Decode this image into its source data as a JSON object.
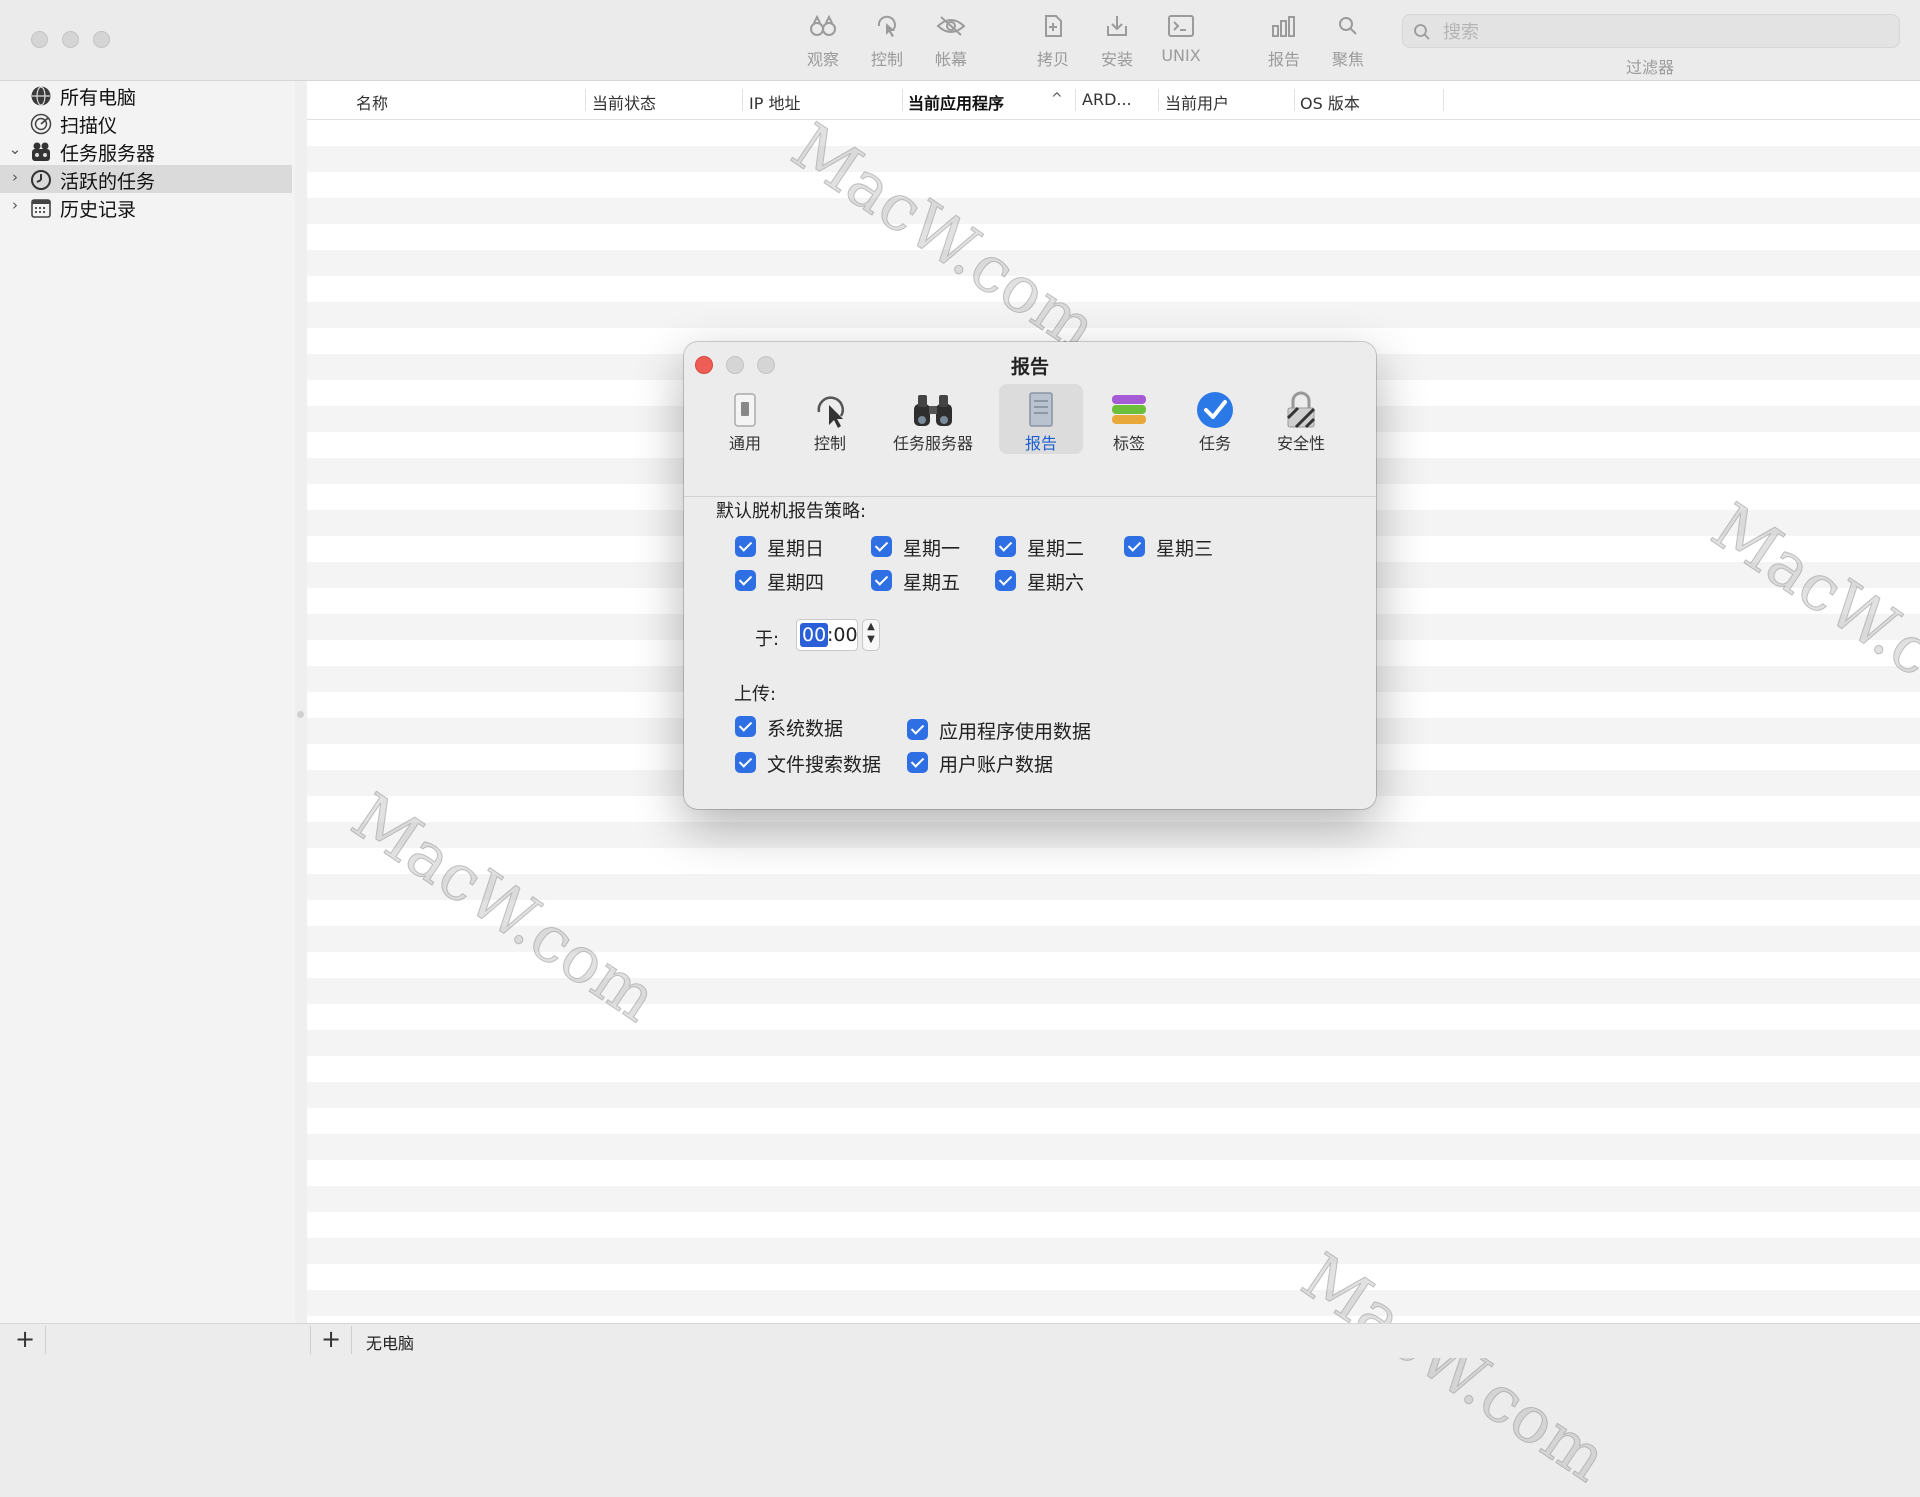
{
  "toolbar": {
    "buttons": [
      {
        "label": "观察",
        "icon": "binoculars-icon"
      },
      {
        "label": "控制",
        "icon": "control-cursor-icon"
      },
      {
        "label": "帐幕",
        "icon": "eye-slash-icon"
      },
      {
        "label": "拷贝",
        "icon": "copy-doc-icon"
      },
      {
        "label": "安装",
        "icon": "install-tray-icon"
      },
      {
        "label": "UNIX",
        "icon": "terminal-icon"
      },
      {
        "label": "报告",
        "icon": "bar-chart-icon"
      },
      {
        "label": "聚焦",
        "icon": "magnifier-icon"
      }
    ],
    "search_placeholder": "搜索",
    "filter_label": "过滤器"
  },
  "sidebar": {
    "items": [
      {
        "label": "所有电脑",
        "icon": "globe-icon",
        "chevron": ""
      },
      {
        "label": "扫描仪",
        "icon": "scanner-radar-icon",
        "chevron": ""
      },
      {
        "label": "任务服务器",
        "icon": "task-server-icon",
        "chevron": "⌄"
      },
      {
        "label": "活跃的任务",
        "icon": "clock-icon",
        "chevron": "›"
      },
      {
        "label": "历史记录",
        "icon": "calendar-icon",
        "chevron": "›"
      }
    ]
  },
  "table": {
    "columns": [
      "名称",
      "当前状态",
      "IP 地址",
      "当前应用程序",
      "ARD...",
      "当前用户",
      "OS 版本"
    ],
    "sorted_column": "当前应用程序",
    "sort_indicator": "^"
  },
  "bottom": {
    "add_label": "+",
    "status": "无电脑"
  },
  "watermark": "MacW.com",
  "dialog": {
    "title": "报告",
    "tabs": [
      {
        "label": "通用",
        "icon": "switch-icon"
      },
      {
        "label": "控制",
        "icon": "control-cursor-icon"
      },
      {
        "label": "任务服务器",
        "icon": "binoculars-icon"
      },
      {
        "label": "报告",
        "icon": "report-doc-icon"
      },
      {
        "label": "标签",
        "icon": "tags-stack-icon"
      },
      {
        "label": "任务",
        "icon": "checkmark-circle-icon"
      },
      {
        "label": "安全性",
        "icon": "padlock-icon"
      }
    ],
    "active_tab": "报告",
    "policy_label": "默认脱机报告策略:",
    "days": [
      {
        "label": "星期日",
        "checked": true
      },
      {
        "label": "星期一",
        "checked": true
      },
      {
        "label": "星期二",
        "checked": true
      },
      {
        "label": "星期三",
        "checked": true
      },
      {
        "label": "星期四",
        "checked": true
      },
      {
        "label": "星期五",
        "checked": true
      },
      {
        "label": "星期六",
        "checked": true
      }
    ],
    "at_label": "于:",
    "time_hour": "00",
    "time_minute": ":00",
    "upload_label": "上传:",
    "uploads": [
      {
        "label": "系统数据",
        "checked": true
      },
      {
        "label": "应用程序使用数据",
        "checked": true
      },
      {
        "label": "文件搜索数据",
        "checked": true
      },
      {
        "label": "用户账户数据",
        "checked": true
      }
    ]
  },
  "colors": {
    "checkbox": "#2f6fe4",
    "close": "#ee5d56",
    "active_tab_text": "#1d5fd1"
  }
}
